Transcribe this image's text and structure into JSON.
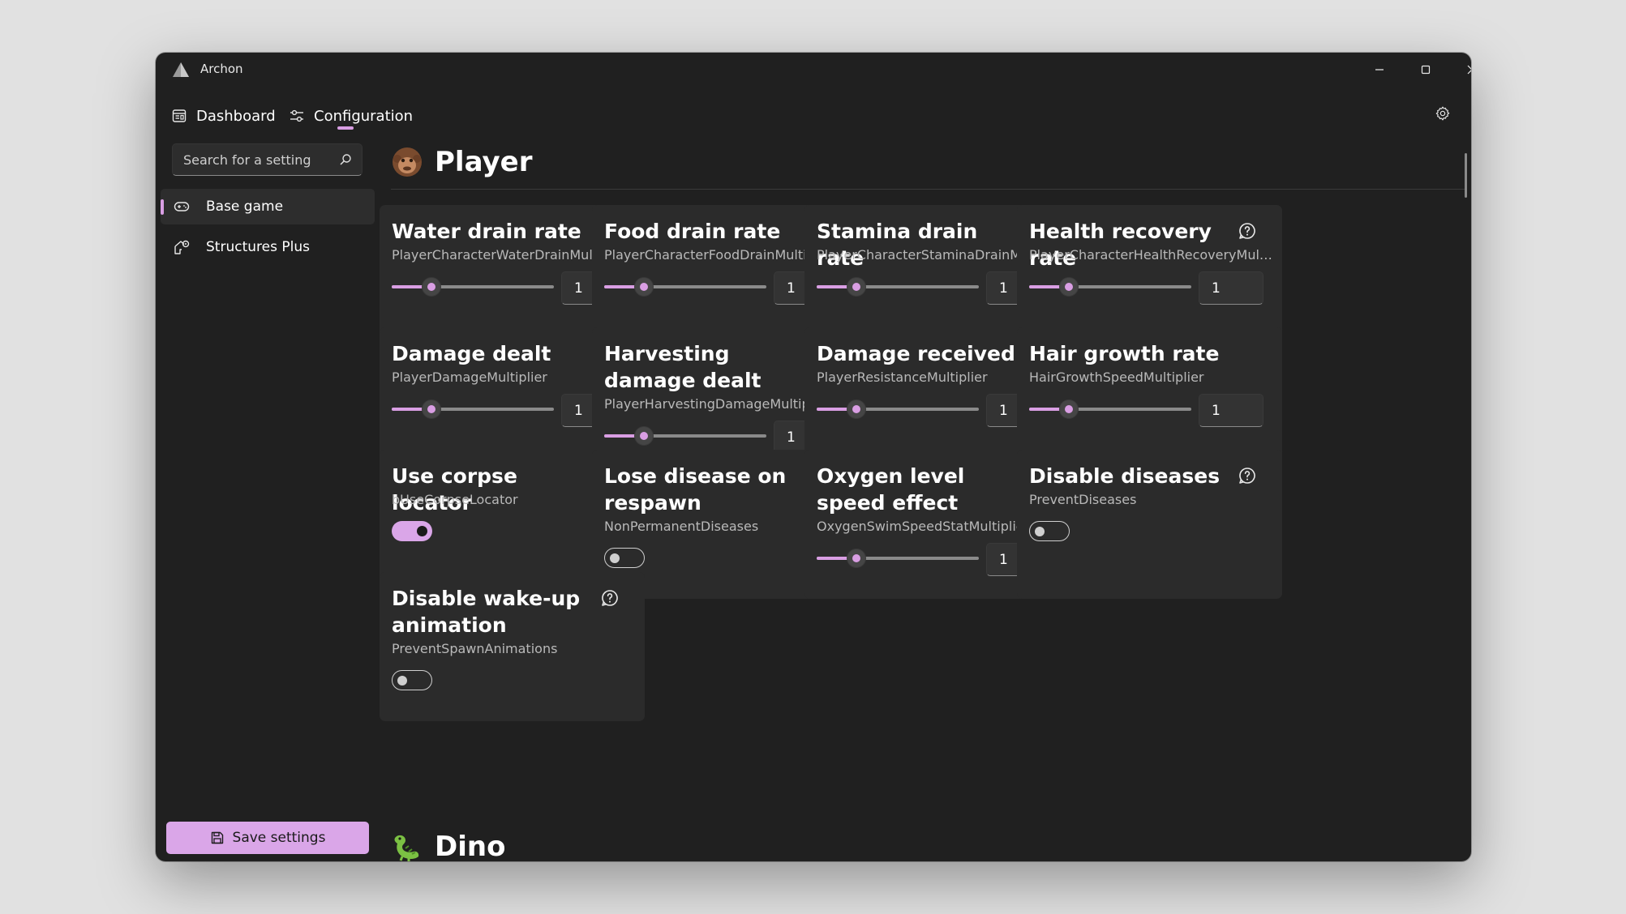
{
  "window": {
    "title": "Archon"
  },
  "nav": {
    "dashboard": "Dashboard",
    "configuration": "Configuration"
  },
  "sidebar": {
    "search_placeholder": "Search for a setting",
    "items": [
      {
        "label": "Base game"
      },
      {
        "label": "Structures Plus"
      }
    ],
    "save_label": "Save settings"
  },
  "sections": {
    "player": "Player",
    "dino": "Dino"
  },
  "cards": [
    {
      "title": "Water drain rate",
      "key": "PlayerCharacterWaterDrainMultiplier",
      "value": "1",
      "slider_fraction": 0.24
    },
    {
      "title": "Food drain rate",
      "key": "PlayerCharacterFoodDrainMultiplier",
      "value": "1",
      "slider_fraction": 0.24
    },
    {
      "title": "Stamina drain rate",
      "key": "PlayerCharacterStaminaDrainMultiplier",
      "value": "1",
      "slider_fraction": 0.24
    },
    {
      "title": "Health recovery rate",
      "key": "PlayerCharacterHealthRecoveryMultip...",
      "value": "1",
      "slider_fraction": 0.24
    },
    {
      "title": "Damage dealt",
      "key": "PlayerDamageMultiplier",
      "value": "1",
      "slider_fraction": 0.24
    },
    {
      "title": "Harvesting damage dealt",
      "key": "PlayerHarvestingDamageMultiplier",
      "value": "1",
      "slider_fraction": 0.24
    },
    {
      "title": "Damage received",
      "key": "PlayerResistanceMultiplier",
      "value": "1",
      "slider_fraction": 0.24
    },
    {
      "title": "Hair growth rate",
      "key": "HairGrowthSpeedMultiplier",
      "value": "1",
      "slider_fraction": 0.24
    },
    {
      "title": "Use corpse locator",
      "key": "bUseCorpseLocator",
      "toggle": true
    },
    {
      "title": "Lose disease on respawn",
      "key": "NonPermanentDiseases",
      "toggle": false
    },
    {
      "title": "Oxygen level speed effect",
      "key": "OxygenSwimSpeedStatMultiplier",
      "value": "1",
      "slider_fraction": 0.24
    },
    {
      "title": "Disable diseases",
      "key": "PreventDiseases",
      "toggle": false
    },
    {
      "title": "Disable wake-up animation",
      "key": "PreventSpawnAnimations",
      "toggle": false
    }
  ],
  "colors": {
    "accent": "#d99ee3",
    "button": "#daa6e8",
    "background": "#202020",
    "card": "#2b2b2b"
  }
}
